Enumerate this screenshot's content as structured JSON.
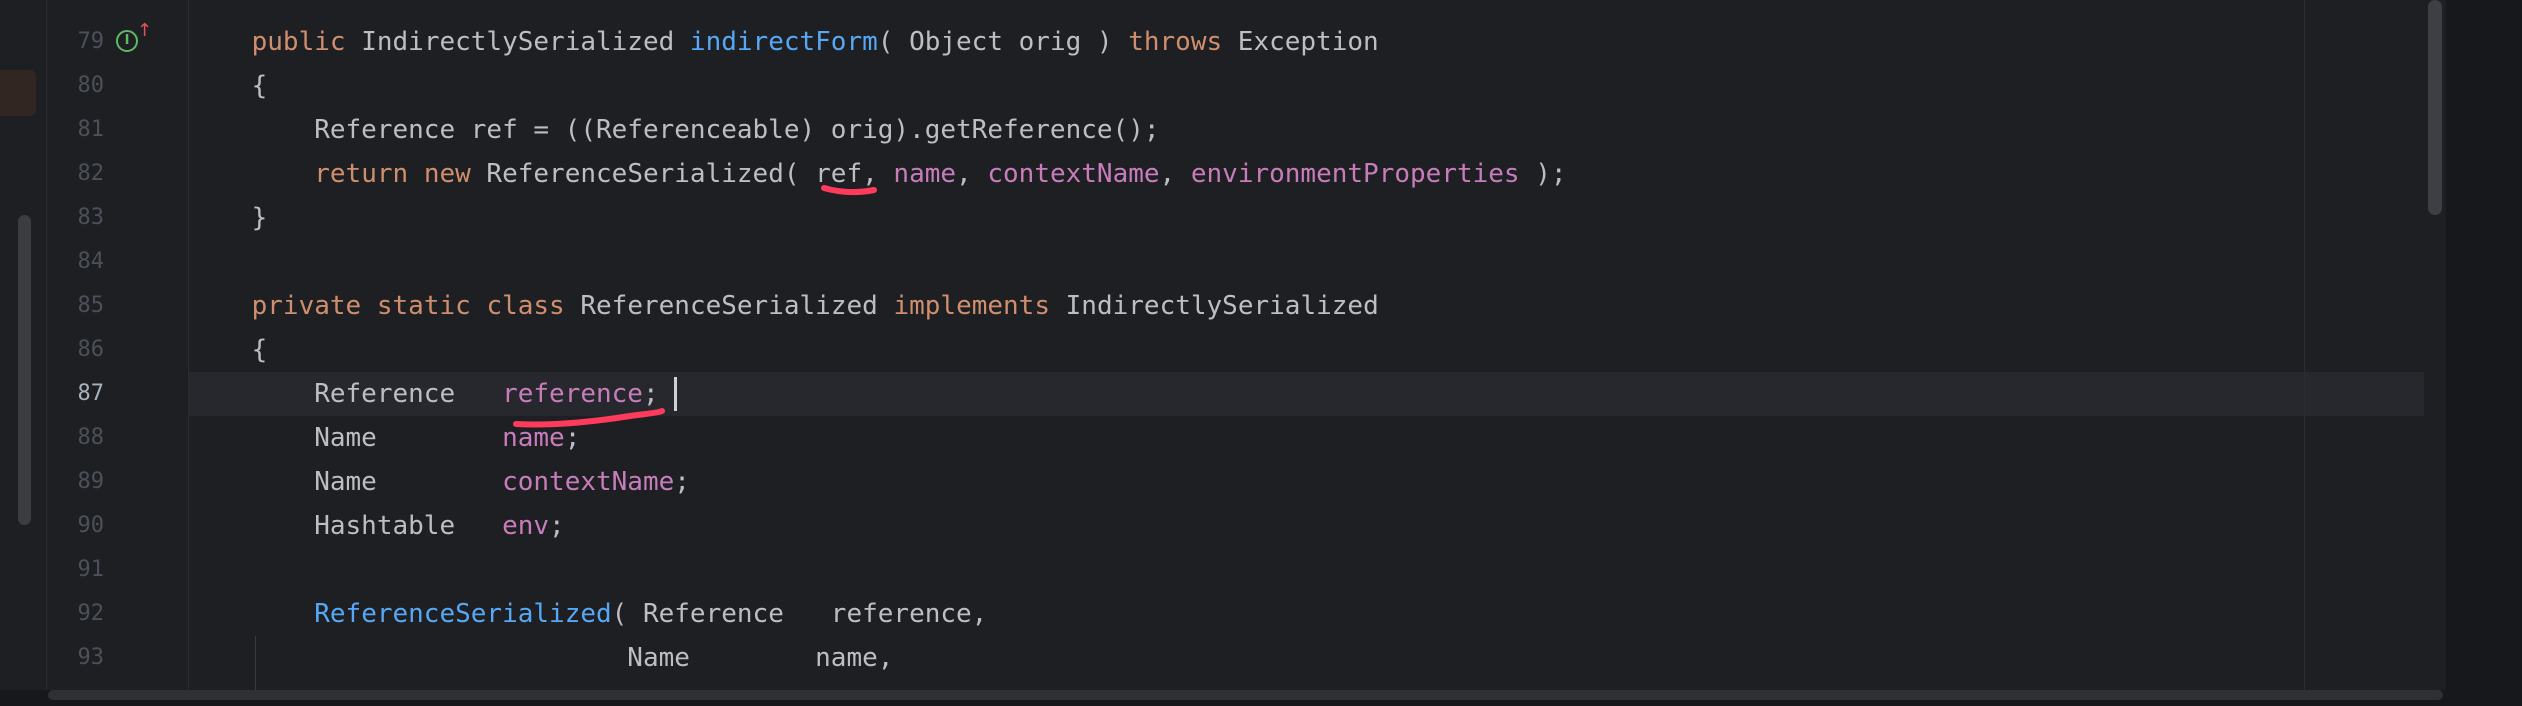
{
  "editor": {
    "current_line": "87",
    "lines": [
      {
        "num": "79",
        "tokens": [
          {
            "t": "    ",
            "c": "txt"
          },
          {
            "t": "public",
            "c": "kw"
          },
          {
            "t": " IndirectlySerialized ",
            "c": "txt"
          },
          {
            "t": "indirectForm",
            "c": "fn"
          },
          {
            "t": "( Object orig ) ",
            "c": "txt"
          },
          {
            "t": "throws",
            "c": "kw"
          },
          {
            "t": " Exception",
            "c": "txt"
          }
        ]
      },
      {
        "num": "80",
        "tokens": [
          {
            "t": "    {",
            "c": "txt"
          }
        ]
      },
      {
        "num": "81",
        "tokens": [
          {
            "t": "        Reference ref = ((Referenceable) orig).getReference();",
            "c": "txt"
          }
        ]
      },
      {
        "num": "82",
        "tokens": [
          {
            "t": "        ",
            "c": "txt"
          },
          {
            "t": "return",
            "c": "kw"
          },
          {
            "t": " ",
            "c": "txt"
          },
          {
            "t": "new",
            "c": "kw"
          },
          {
            "t": " ReferenceSerialized( ref, ",
            "c": "txt"
          },
          {
            "t": "name",
            "c": "fld"
          },
          {
            "t": ", ",
            "c": "txt"
          },
          {
            "t": "contextName",
            "c": "fld"
          },
          {
            "t": ", ",
            "c": "txt"
          },
          {
            "t": "environmentProperties",
            "c": "fld"
          },
          {
            "t": " );",
            "c": "txt"
          }
        ]
      },
      {
        "num": "83",
        "tokens": [
          {
            "t": "    }",
            "c": "txt"
          }
        ]
      },
      {
        "num": "84",
        "tokens": []
      },
      {
        "num": "85",
        "tokens": [
          {
            "t": "    ",
            "c": "txt"
          },
          {
            "t": "private",
            "c": "kw"
          },
          {
            "t": " ",
            "c": "txt"
          },
          {
            "t": "static",
            "c": "kw"
          },
          {
            "t": " ",
            "c": "txt"
          },
          {
            "t": "class",
            "c": "kw"
          },
          {
            "t": " ReferenceSerialized ",
            "c": "txt"
          },
          {
            "t": "implements",
            "c": "kw"
          },
          {
            "t": " IndirectlySerialized",
            "c": "txt"
          }
        ]
      },
      {
        "num": "86",
        "tokens": [
          {
            "t": "    {",
            "c": "txt"
          }
        ]
      },
      {
        "num": "87",
        "tokens": [
          {
            "t": "        Reference   ",
            "c": "txt"
          },
          {
            "t": "reference",
            "c": "fld"
          },
          {
            "t": ";",
            "c": "txt"
          }
        ]
      },
      {
        "num": "88",
        "tokens": [
          {
            "t": "        Name        ",
            "c": "txt"
          },
          {
            "t": "name",
            "c": "fld"
          },
          {
            "t": ";",
            "c": "txt"
          }
        ]
      },
      {
        "num": "89",
        "tokens": [
          {
            "t": "        Name        ",
            "c": "txt"
          },
          {
            "t": "contextName",
            "c": "fld"
          },
          {
            "t": ";",
            "c": "txt"
          }
        ]
      },
      {
        "num": "90",
        "tokens": [
          {
            "t": "        Hashtable   ",
            "c": "txt"
          },
          {
            "t": "env",
            "c": "fld"
          },
          {
            "t": ";",
            "c": "txt"
          }
        ]
      },
      {
        "num": "91",
        "tokens": []
      },
      {
        "num": "92",
        "tokens": [
          {
            "t": "        ",
            "c": "txt"
          },
          {
            "t": "ReferenceSerialized",
            "c": "fn"
          },
          {
            "t": "( Reference   reference,",
            "c": "txt"
          }
        ]
      },
      {
        "num": "93",
        "tokens": [
          {
            "t": "                            Name        name,",
            "c": "txt"
          }
        ]
      }
    ]
  },
  "gutter": {
    "implements_icon": "implementing-method-icon",
    "implements_glyph": "I",
    "arrow_glyph": "↑"
  },
  "colors": {
    "keyword": "#cf8e6d",
    "function": "#56a8f5",
    "field": "#c77dbb",
    "text": "#bcbec4",
    "annotation_ink": "#ff3b5c"
  }
}
